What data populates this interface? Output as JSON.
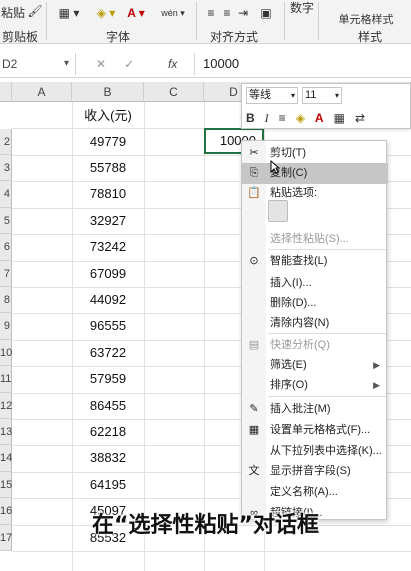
{
  "ribbon": {
    "groups": [
      "剪贴板",
      "字体",
      "对齐方式",
      "样式"
    ],
    "number_label": "数字",
    "cell_style_label": "单元格样式",
    "paste_label": "粘贴"
  },
  "formula_bar": {
    "name_box": "D2",
    "fx_label": "fx",
    "value": "10000"
  },
  "columns": [
    "A",
    "B",
    "C",
    "D"
  ],
  "header_cell": "收入(元)",
  "rows": [
    "2",
    "3",
    "4",
    "5",
    "6",
    "7",
    "8",
    "9",
    "10",
    "11",
    "12",
    "13",
    "14",
    "15",
    "16",
    "17"
  ],
  "values": [
    "49779",
    "55788",
    "78810",
    "32927",
    "73242",
    "67099",
    "44092",
    "96555",
    "63722",
    "57959",
    "86455",
    "62218",
    "38832",
    "64195",
    "45097",
    "85532"
  ],
  "selected_cell": "10000",
  "mini_toolbar": {
    "font": "等线",
    "size": "11",
    "bold": "B",
    "italic": "I",
    "font_color": "A"
  },
  "context_menu": {
    "items": [
      {
        "label": "剪切(T)",
        "icon": "scissors-icon"
      },
      {
        "label": "复制(C)",
        "icon": "copy-icon"
      },
      {
        "label": "粘贴选项:",
        "icon": "paste-icon"
      },
      {
        "label": "选择性粘贴(S)...",
        "icon": ""
      },
      {
        "label": "智能查找(L)",
        "icon": "smart-lookup-icon"
      },
      {
        "label": "插入(I)...",
        "icon": ""
      },
      {
        "label": "删除(D)...",
        "icon": ""
      },
      {
        "label": "清除内容(N)",
        "icon": ""
      },
      {
        "label": "快速分析(Q)",
        "icon": "quick-analysis-icon"
      },
      {
        "label": "筛选(E)",
        "icon": ""
      },
      {
        "label": "排序(O)",
        "icon": ""
      },
      {
        "label": "插入批注(M)",
        "icon": "comment-icon"
      },
      {
        "label": "设置单元格格式(F)...",
        "icon": "format-cells-icon"
      },
      {
        "label": "从下拉列表中选择(K)...",
        "icon": ""
      },
      {
        "label": "显示拼音字段(S)",
        "icon": "phonetic-icon"
      },
      {
        "label": "定义名称(A)...",
        "icon": ""
      },
      {
        "label": "超链接(I)...",
        "icon": "hyperlink-icon"
      }
    ]
  },
  "subtitle": "在“选择性粘贴”对话框"
}
